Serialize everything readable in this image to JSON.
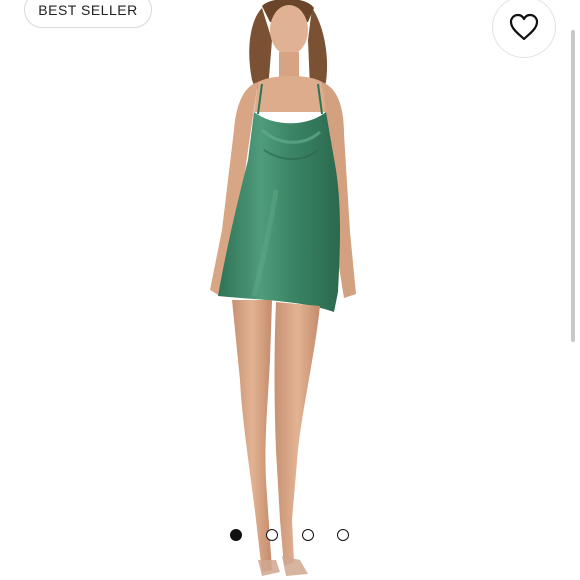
{
  "badge": {
    "label": "BEST SELLER"
  },
  "favorite": {
    "icon": "heart-outline-icon"
  },
  "product_image": {
    "subject": "model-in-green-satin-slip-dress"
  },
  "carousel": {
    "total": 4,
    "active_index": 0
  },
  "colors": {
    "dress": "#3f8a6a",
    "skin": "#d9a988",
    "hair": "#7a5233"
  }
}
